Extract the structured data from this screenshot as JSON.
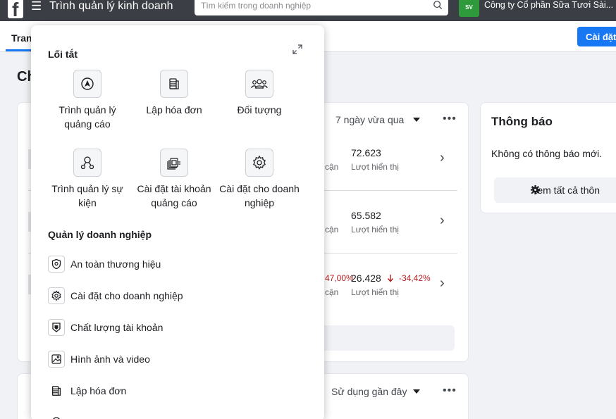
{
  "topbar": {
    "app_title": "Trình quản lý kinh doanh",
    "search_placeholder": "Tìm kiếm trong doanh nghiệp",
    "company_name": "Công ty Cổ phần Sữa Tươi Sài...",
    "logo_letter": "f"
  },
  "subbar": {
    "home_tab": "Tran",
    "settings_button": "Cài đặt"
  },
  "page": {
    "heading": "Ch"
  },
  "performance": {
    "period": "7 ngày vừa qua",
    "rows": [
      {
        "reach_label": "cận",
        "value": "72.623",
        "label": "Lượt hiển thị"
      },
      {
        "reach_label": "cận",
        "value": "65.582",
        "label": "Lượt hiển thị"
      },
      {
        "reach_label": "cận",
        "change": "47,00%",
        "value": "26.428",
        "delta": "-34,42%",
        "label": "Lượt hiển thị"
      }
    ]
  },
  "bottom_card": {
    "sort_label": "Sử dụng gần đây"
  },
  "notifications": {
    "title": "Thông báo",
    "body": "Không có thông báo mới.",
    "view_all": "Xem tất cả thôn"
  },
  "panel": {
    "shortcuts_title": "Lối tắt",
    "shortcuts": [
      {
        "label": "Trình quản lý quảng cáo",
        "icon": "ads-manager-icon"
      },
      {
        "label": "Lập hóa đơn",
        "icon": "billing-icon"
      },
      {
        "label": "Đối tượng",
        "icon": "audience-icon"
      },
      {
        "label": "Trình quản lý sự kiện",
        "icon": "events-manager-icon"
      },
      {
        "label": "Cài đặt tài khoản quảng cáo",
        "icon": "ad-account-settings-icon"
      },
      {
        "label": "Cài đặt cho doanh nghiệp",
        "icon": "business-settings-icon"
      }
    ],
    "management_title": "Quản lý doanh nghiệp",
    "management_items": [
      {
        "label": "An toàn thương hiệu",
        "icon": "shield-icon"
      },
      {
        "label": "Cài đặt cho doanh nghiệp",
        "icon": "gear-icon"
      },
      {
        "label": "Chất lượng tài khoản",
        "icon": "badge-shield-icon"
      },
      {
        "label": "Hình ảnh và video",
        "icon": "image-icon"
      },
      {
        "label": "Lập hóa đơn",
        "icon": "billing-icon"
      }
    ]
  },
  "colors": {
    "topbar": "#3b3e44",
    "accent": "#1877f2",
    "negative": "#b71c1c"
  }
}
